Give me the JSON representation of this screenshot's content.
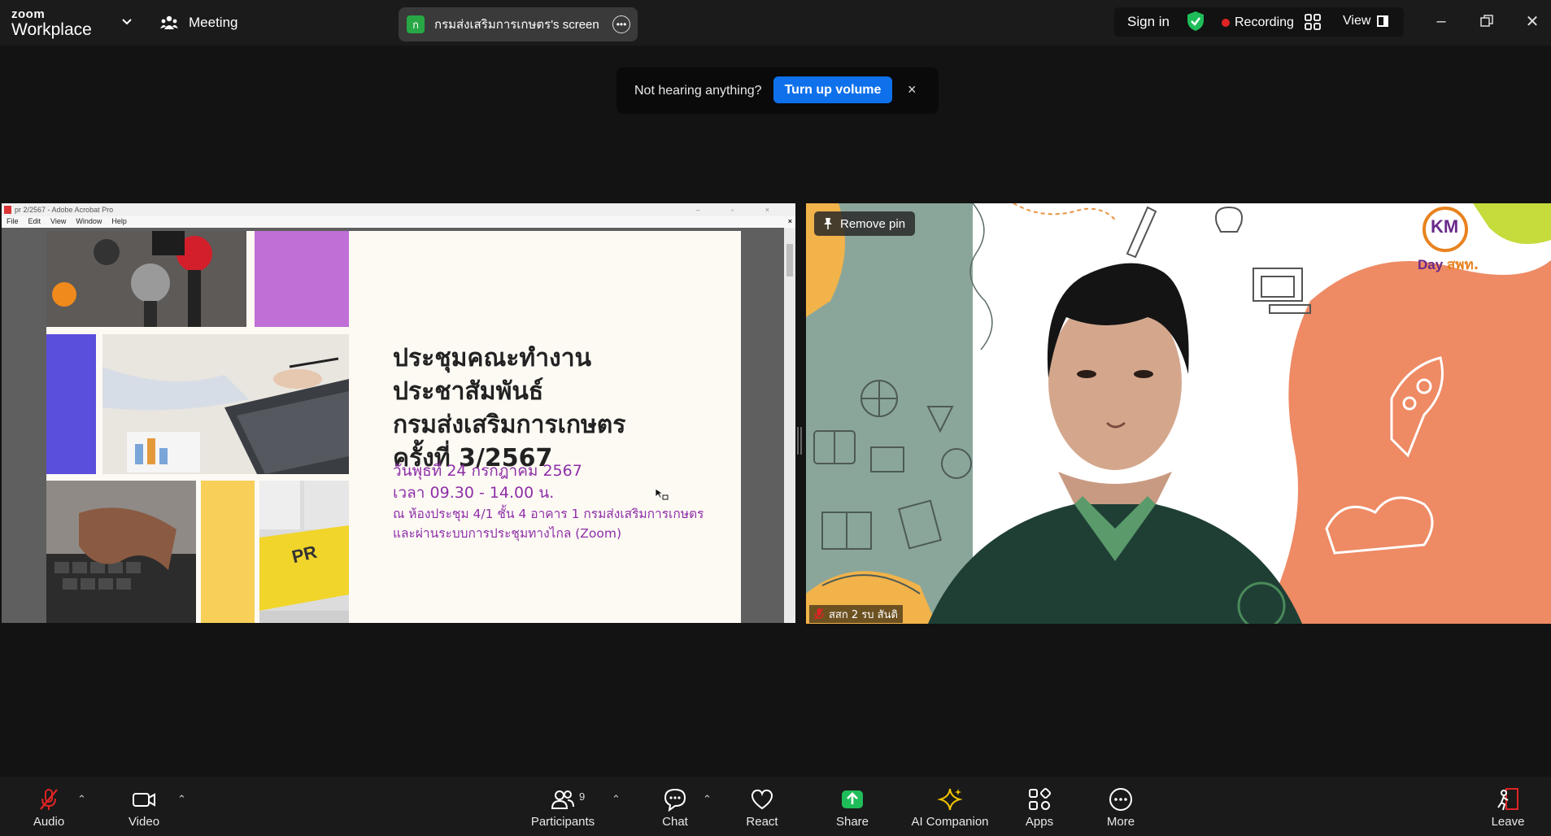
{
  "app": {
    "brand_top": "zoom",
    "brand_bottom": "Workplace",
    "meeting_label": "Meeting"
  },
  "screen_share": {
    "badge_letter": "ก",
    "label": "กรมส่งเสริมการเกษตร's screen"
  },
  "top_right": {
    "sign_in": "Sign in",
    "recording": "Recording",
    "view": "View"
  },
  "notice": {
    "text": "Not hearing anything?",
    "button": "Turn up volume",
    "close": "×"
  },
  "acrobat": {
    "title": "pr 2/2567 - Adobe Acrobat Pro",
    "menu": [
      "File",
      "Edit",
      "View",
      "Window",
      "Help"
    ]
  },
  "slide": {
    "title_lines": [
      "ประชุมคณะทำงานประชาสัมพันธ์",
      "กรมส่งเสริมการเกษตร",
      "ครั้งที่ 3/2567"
    ],
    "date": "วันพุธที่ 24 กรกฎาคม 2567",
    "time": "เวลา 09.30 - 14.00 น.",
    "place": "ณ ห้องประชุม 4/1 ชั้น 4 อาคาร 1 กรมส่งเสริมการเกษตร",
    "online": "และผ่านระบบการประชุมทางไกล (Zoom)",
    "pr_key": "PR"
  },
  "camera": {
    "remove_pin": "Remove pin",
    "participant_name": "สสก 2 รบ สันติ",
    "logo_letters": "KM",
    "logo_text_1": "Day",
    "logo_text_2": "สพท."
  },
  "toolbar": {
    "audio": "Audio",
    "video": "Video",
    "participants": "Participants",
    "participants_count": "9",
    "chat": "Chat",
    "react": "React",
    "share": "Share",
    "ai_companion": "AI Companion",
    "apps": "Apps",
    "more": "More",
    "leave": "Leave"
  },
  "colors": {
    "accent_blue": "#0e71eb",
    "share_green": "#1fbd5a",
    "recording_red": "#e02424",
    "slide_purple": "#8e2fa8"
  }
}
